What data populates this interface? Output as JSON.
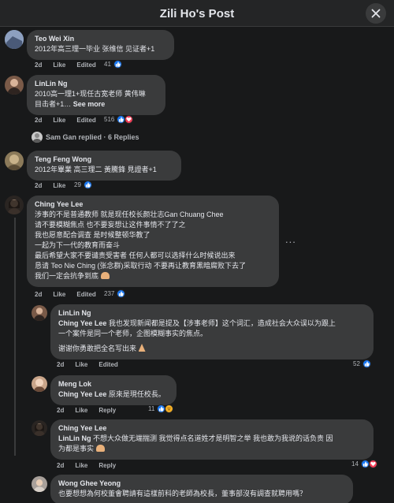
{
  "header": {
    "title": "Zili Ho's Post"
  },
  "comments": [
    {
      "author": "Teo Wei Xin",
      "lines": [
        "2012年高三理一毕业 张维信 见证者+1"
      ],
      "time": "2d",
      "like": "Like",
      "reply": "Edited",
      "count": "41"
    },
    {
      "author": "LinLin Ng",
      "lines": [
        "2010高一理1+现任古宽老师 黄伟琳",
        "目击者+1…"
      ],
      "see_more": "See more",
      "time": "2d",
      "like": "Like",
      "reply": "Edited",
      "count": "516"
    },
    {
      "replies_text": "Sam Gan replied · 6 Replies"
    },
    {
      "author": "Teng Feng Wong",
      "lines": [
        "2012年畢業 高三理二 黃騰鋒 見證者+1"
      ],
      "time": "2d",
      "like": "Like",
      "count": "29"
    },
    {
      "author": "Ching Yee Lee",
      "lines": [
        "涉事的不是普通教师 就是现任校长颜壮志Gan Chuang Chee",
        "请不要模糊焦点 也不要妄想让这件事情不了了之",
        "我也愿意配合调查 是时候整顿华教了",
        "一起为下一代的教育而奋斗",
        "最后希望大家不要谴责受害者 任何人都可以选择什么时候说出来",
        "恳请 Teo Nie Ching (张念群)采取行动 不要再让教育黑暗腐败下去了",
        "我们一定会抗争到底"
      ],
      "time": "2d",
      "like": "Like",
      "reply": "Edited",
      "count": "237",
      "more": "..."
    },
    {
      "author": "LinLin Ng",
      "tag": "Ching Yee Lee",
      "lines": [
        " 我也发现新闻都是提及【涉事老师】这个词汇，造成社会大众误以为跟上",
        "一个案件是同一个老师，企图模糊事实的焦点。"
      ],
      "extra": "谢谢你勇敢把全名写出来",
      "time": "2d",
      "like": "Like",
      "reply": "Edited",
      "count": "52"
    },
    {
      "author": "Meng Lok",
      "tag": "Ching Yee Lee",
      "lines": [
        " 原來是現任校長。"
      ],
      "time": "2d",
      "like": "Like",
      "reply": "Reply",
      "count": "11"
    },
    {
      "author": "Ching Yee Lee",
      "tag": "LinLin Ng",
      "lines": [
        " 不想大众做无端揣测 我觉得点名道姓才是明智之举 我也敢为我说的话负责 因",
        "为都是事实"
      ],
      "time": "2d",
      "like": "Like",
      "reply": "Reply",
      "count": "14"
    },
    {
      "author": "Wong Ghee Yeong",
      "lines": [
        "也要想想為何校董會聘請有這樣前科的老師為校長，董事部沒有調查就聘用嗎？"
      ]
    }
  ],
  "colors": {
    "like": "#1877f2",
    "heart": "#f33e58",
    "sad": "#f7b125",
    "bubble": "#3a3b3c",
    "background": "#18191a"
  }
}
